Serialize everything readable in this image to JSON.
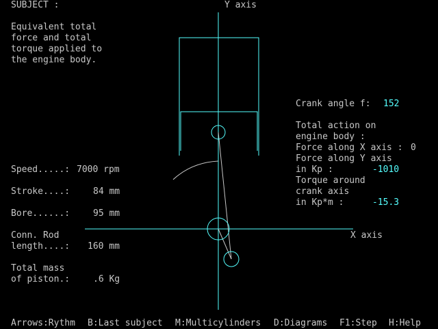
{
  "header": {
    "subject_label": "SUBJECT :",
    "y_axis_label": "Y axis",
    "x_axis_label": "X axis"
  },
  "subject_text": [
    "Equivalent total",
    "force and total",
    "torque applied to",
    "the engine body."
  ],
  "parameters": {
    "speed_label": "Speed.....:",
    "speed_value": "7000 rpm",
    "stroke_label": "Stroke....:",
    "stroke_value": "84 mm",
    "bore_label": "Bore......:",
    "bore_value": "95 mm",
    "conn_rod_label_1": "Conn. Rod",
    "conn_rod_label_2": "length....:",
    "conn_rod_value": "160 mm",
    "mass_label_1": "Total mass",
    "mass_label_2": "of piston.:",
    "mass_value": ".6 Kg"
  },
  "results": {
    "crank_angle_label": "Crank angle f:",
    "crank_angle_value": "152",
    "total_action_1": "Total action on",
    "total_action_2": "engine body :",
    "force_x_label": "Force along X axis :",
    "force_x_value": "0",
    "force_y_label_1": "Force along Y axis",
    "force_y_label_2": "in Kp :",
    "force_y_value": "-1010",
    "torque_label_1": "Torque around",
    "torque_label_2": "crank axis",
    "torque_label_3": "in Kp*m :",
    "torque_value": "-15.3"
  },
  "footer_menu": [
    "Arrows:Rythm",
    "B:Last subject",
    "M:Multicylinders",
    "D:Diagrams",
    "F1:Step",
    "H:Help"
  ],
  "colors": {
    "background": "#000000",
    "text": "#c8c8c8",
    "highlight": "#55ffff",
    "axes": "#55ffff",
    "mechanism": "#55ffff",
    "connecting_rod": "#c8c8c8"
  }
}
